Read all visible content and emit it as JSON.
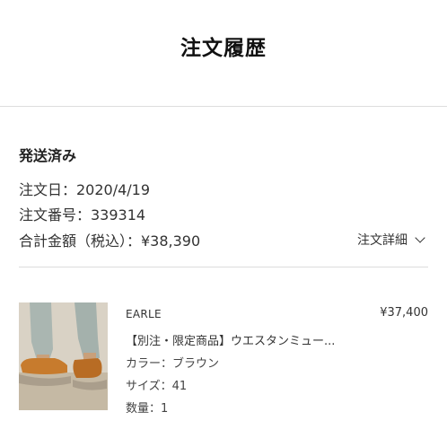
{
  "header": {
    "title": "注文履歴"
  },
  "order": {
    "status": "発送済み",
    "date_line": "注文日：2020/4/19",
    "number_line": "注文番号：339314",
    "total_line": "合計金額（税込）：¥38,390",
    "detail_link_label": "注文詳細",
    "detail_link_icon": "chevron-down-icon"
  },
  "item": {
    "brand": "EARLE",
    "price": "¥37,400",
    "name": "【別注・限定商品】ウエスタンミュー...",
    "color_line": "カラー：ブラウン",
    "size_line": "サイズ：41",
    "quantity_line": "数量：1",
    "image_desc": "product-photo-brown-shoes"
  },
  "colors": {
    "text": "#333333",
    "divider": "#dddddd",
    "shoe": "#c47a2c",
    "denim": "#a9b5b0"
  }
}
